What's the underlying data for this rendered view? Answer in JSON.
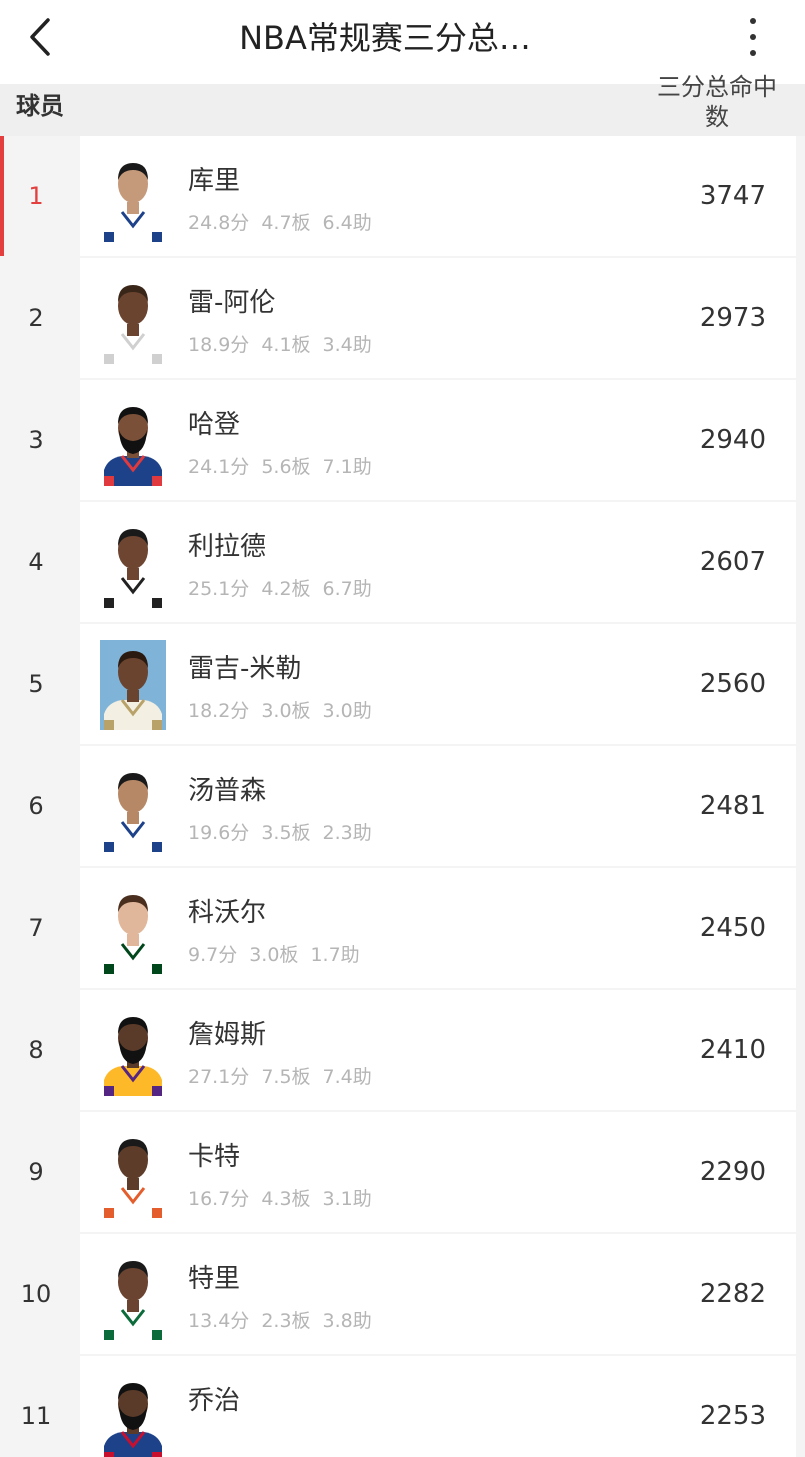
{
  "header": {
    "title": "NBA常规赛三分总…",
    "col_player": "球员",
    "col_stat": "三分总命中数"
  },
  "colors": {
    "accent": "#e33f3f",
    "stat_text": "#b5b5b5"
  },
  "players": [
    {
      "rank": "1",
      "name": "库里",
      "pts": "24.8分",
      "reb": "4.7板",
      "ast": "6.4助",
      "value": "3747",
      "jersey": "#ffffff",
      "trim": "#1d428a",
      "skin": "#c59a7a",
      "hair": "#1a1a1a",
      "beard": false
    },
    {
      "rank": "2",
      "name": "雷-阿伦",
      "pts": "18.9分",
      "reb": "4.1板",
      "ast": "3.4助",
      "value": "2973",
      "jersey": "#ffffff",
      "trim": "#d0d0d0",
      "skin": "#6b4430",
      "hair": "#3a2618",
      "beard": false
    },
    {
      "rank": "3",
      "name": "哈登",
      "pts": "24.1分",
      "reb": "5.6板",
      "ast": "7.1助",
      "value": "2940",
      "jersey": "#1d428a",
      "trim": "#e03a3e",
      "skin": "#7a5038",
      "hair": "#111111",
      "beard": true
    },
    {
      "rank": "4",
      "name": "利拉德",
      "pts": "25.1分",
      "reb": "4.2板",
      "ast": "6.7助",
      "value": "2607",
      "jersey": "#ffffff",
      "trim": "#222222",
      "skin": "#6d4530",
      "hair": "#1a1a1a",
      "beard": false
    },
    {
      "rank": "5",
      "name": "雷吉-米勒",
      "pts": "18.2分",
      "reb": "3.0板",
      "ast": "3.0助",
      "value": "2560",
      "jersey": "#f3efe2",
      "trim": "#b8a26a",
      "skin": "#6b4430",
      "hair": "#2a1a10",
      "beard": false,
      "bg": "#7fb4d8"
    },
    {
      "rank": "6",
      "name": "汤普森",
      "pts": "19.6分",
      "reb": "3.5板",
      "ast": "2.3助",
      "value": "2481",
      "jersey": "#ffffff",
      "trim": "#1d428a",
      "skin": "#b68866",
      "hair": "#1a1a1a",
      "beard": false
    },
    {
      "rank": "7",
      "name": "科沃尔",
      "pts": "9.7分",
      "reb": "3.0板",
      "ast": "1.7助",
      "value": "2450",
      "jersey": "#ffffff",
      "trim": "#00471b",
      "skin": "#e0b79a",
      "hair": "#4a2f1e",
      "beard": false
    },
    {
      "rank": "8",
      "name": "詹姆斯",
      "pts": "27.1分",
      "reb": "7.5板",
      "ast": "7.4助",
      "value": "2410",
      "jersey": "#fdb927",
      "trim": "#552583",
      "skin": "#5a3a28",
      "hair": "#111111",
      "beard": true
    },
    {
      "rank": "9",
      "name": "卡特",
      "pts": "16.7分",
      "reb": "4.3板",
      "ast": "3.1助",
      "value": "2290",
      "jersey": "#ffffff",
      "trim": "#e35e2c",
      "skin": "#5e3c2a",
      "hair": "#1a1a1a",
      "beard": false
    },
    {
      "rank": "10",
      "name": "特里",
      "pts": "13.4分",
      "reb": "2.3板",
      "ast": "3.8助",
      "value": "2282",
      "jersey": "#ffffff",
      "trim": "#0c6b3a",
      "skin": "#6a4430",
      "hair": "#1a1a1a",
      "beard": false
    },
    {
      "rank": "11",
      "name": "乔治",
      "pts": "",
      "reb": "",
      "ast": "",
      "value": "2253",
      "jersey": "#1d428a",
      "trim": "#c8102e",
      "skin": "#5a3a28",
      "hair": "#111111",
      "beard": true
    }
  ]
}
